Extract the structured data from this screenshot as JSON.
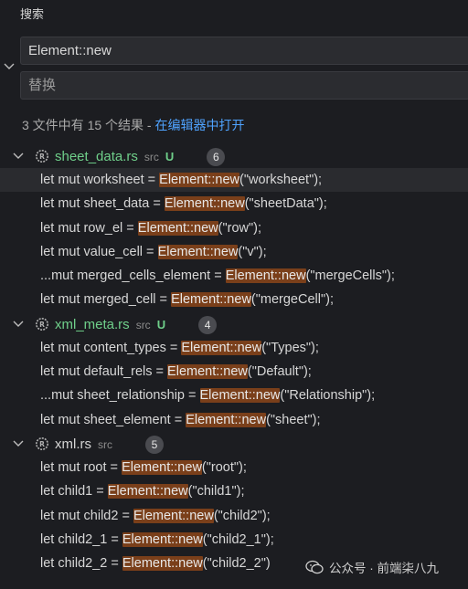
{
  "panel": {
    "title": "搜索",
    "search_value": "Element::new",
    "replace_placeholder": "替换"
  },
  "summary": {
    "text": "3 文件中有 15 个结果 - ",
    "link": "在编辑器中打开"
  },
  "files": [
    {
      "name": "sheet_data.rs",
      "dir": "src",
      "status": "U",
      "count": "6",
      "matches": [
        {
          "pre": "let mut worksheet = ",
          "hit": "Element::new",
          "post": "(\"worksheet\");"
        },
        {
          "pre": "let mut sheet_data = ",
          "hit": "Element::new",
          "post": "(\"sheetData\");"
        },
        {
          "pre": "let mut row_el = ",
          "hit": "Element::new",
          "post": "(\"row\");"
        },
        {
          "pre": "let mut value_cell = ",
          "hit": "Element::new",
          "post": "(\"v\");"
        },
        {
          "pre": "...mut merged_cells_element = ",
          "hit": "Element::new",
          "post": "(\"mergeCells\");"
        },
        {
          "pre": "let mut merged_cell = ",
          "hit": "Element::new",
          "post": "(\"mergeCell\");"
        }
      ]
    },
    {
      "name": "xml_meta.rs",
      "dir": "src",
      "status": "U",
      "count": "4",
      "matches": [
        {
          "pre": "let mut content_types = ",
          "hit": "Element::new",
          "post": "(\"Types\");"
        },
        {
          "pre": "let mut default_rels = ",
          "hit": "Element::new",
          "post": "(\"Default\");"
        },
        {
          "pre": "...mut sheet_relationship = ",
          "hit": "Element::new",
          "post": "(\"Relationship\");"
        },
        {
          "pre": "let mut sheet_element = ",
          "hit": "Element::new",
          "post": "(\"sheet\");"
        }
      ]
    },
    {
      "name": "xml.rs",
      "dir": "src",
      "status": "",
      "count": "5",
      "matches": [
        {
          "pre": "let mut root = ",
          "hit": "Element::new",
          "post": "(\"root\");"
        },
        {
          "pre": "let child1 = ",
          "hit": "Element::new",
          "post": "(\"child1\");"
        },
        {
          "pre": "let mut child2 = ",
          "hit": "Element::new",
          "post": "(\"child2\");"
        },
        {
          "pre": "let child2_1 = ",
          "hit": "Element::new",
          "post": "(\"child2_1\");"
        },
        {
          "pre": "let child2_2 = ",
          "hit": "Element::new",
          "post": "(\"child2_2\")"
        }
      ]
    }
  ],
  "watermark": {
    "icon": "wechat-icon",
    "text": "公众号 · 前端柒八九"
  },
  "colors": {
    "highlight": "#7a3f1a",
    "modified_file": "#6fcf8a",
    "link": "#4fa3ff",
    "background": "#1c1d21"
  }
}
